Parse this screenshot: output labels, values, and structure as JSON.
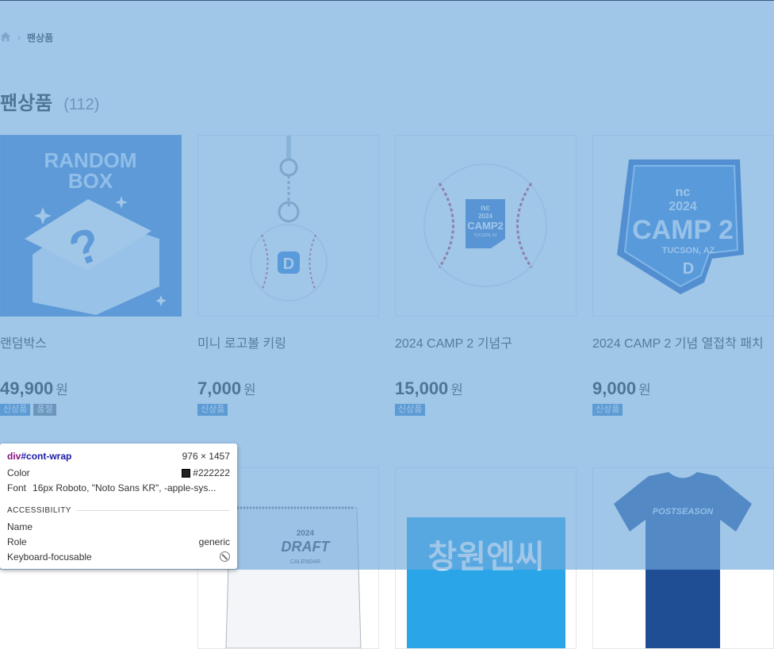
{
  "breadcrumb": {
    "current": "팬상품"
  },
  "title": {
    "text": "팬상품",
    "count": "(112)"
  },
  "products": [
    {
      "name": "랜덤박스",
      "price": "49,900",
      "unit": "원",
      "badges": [
        "신상품",
        "품절"
      ]
    },
    {
      "name": "미니 로고볼 키링",
      "price": "7,000",
      "unit": "원",
      "badges": [
        "신상품"
      ]
    },
    {
      "name": "2024 CAMP 2 기념구",
      "price": "15,000",
      "unit": "원",
      "badges": [
        "신상품"
      ]
    },
    {
      "name": "2024 CAMP 2 기념 열접착 패치",
      "price": "9,000",
      "unit": "원",
      "badges": [
        "신상품"
      ]
    }
  ],
  "images": {
    "random_box": {
      "line1": "RANDOM",
      "line2": "BOX"
    },
    "ball": {
      "stamp_top": "nc",
      "stamp_year": "2024",
      "stamp_main": "CAMP2",
      "stamp_sub": "TUCSON, AZ"
    },
    "patch": {
      "top": "nc",
      "year": "2024",
      "main": "CAMP 2",
      "sub": "TUCSON, AZ"
    },
    "calendar": {
      "year": "2024",
      "main": "DRAFT",
      "sub": "CALENDAR"
    },
    "banner": {
      "text": "창원엔씨"
    },
    "tshirt": {
      "text": "POSTSEASON"
    }
  },
  "tooltip": {
    "selector_tag": "div",
    "selector_id": "#cont-wrap",
    "size": "976 × 1457",
    "color_label": "Color",
    "color_value": "#222222",
    "font_label": "Font",
    "font_value": "16px Roboto, \"Noto Sans KR\", -apple-sys...",
    "section": "ACCESSIBILITY",
    "name_label": "Name",
    "name_value": "",
    "role_label": "Role",
    "role_value": "generic",
    "focus_label": "Keyboard-focusable"
  },
  "colors": {
    "overlay": "#6fa8dc",
    "badge_new": "#3b82c4",
    "badge_soldout": "#6b7280"
  }
}
